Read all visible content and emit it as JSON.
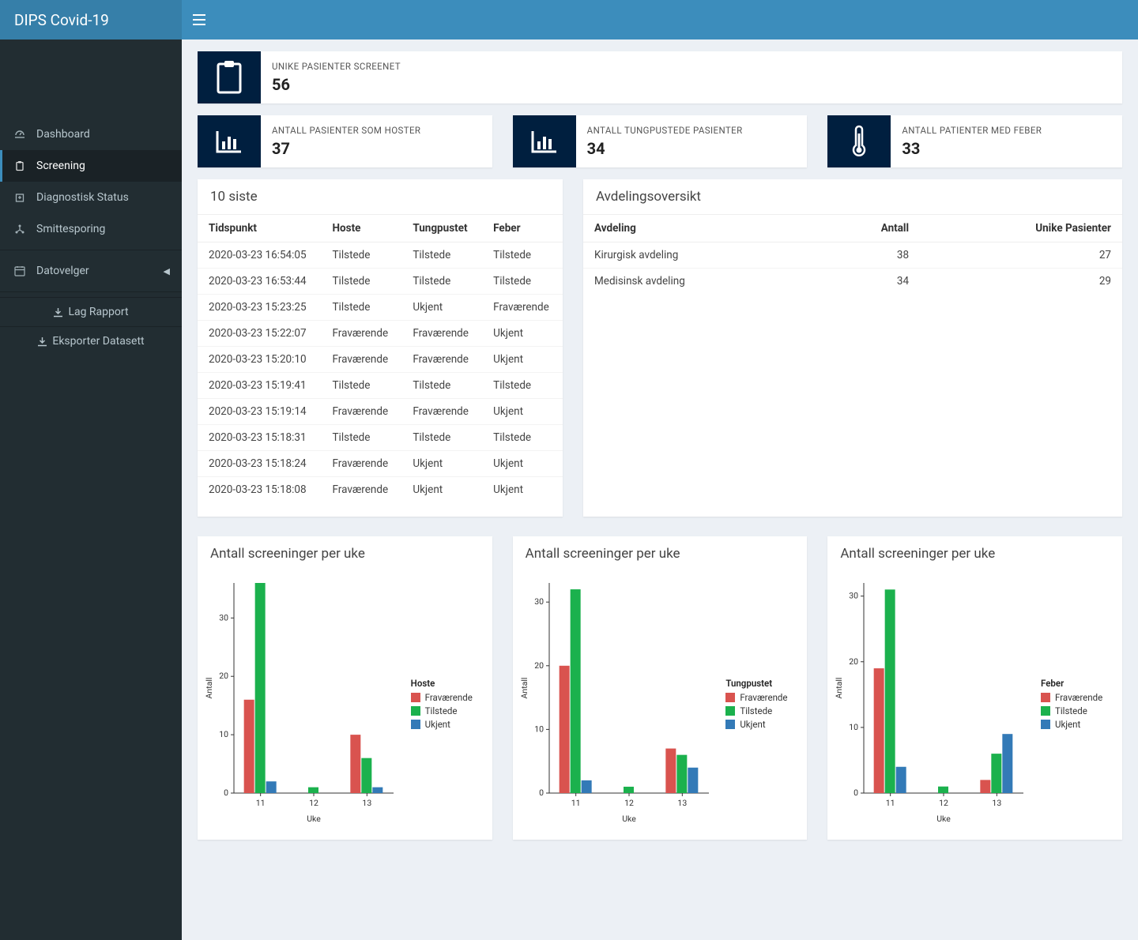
{
  "header": {
    "brand": "DIPS Covid-19"
  },
  "sidebar": {
    "items": [
      {
        "label": "Dashboard",
        "icon": "dashboard"
      },
      {
        "label": "Screening",
        "icon": "clipboard",
        "active": true
      },
      {
        "label": "Diagnostisk Status",
        "icon": "hospital"
      },
      {
        "label": "Smittesporing",
        "icon": "network"
      }
    ],
    "datepicker_label": "Datovelger",
    "report_label": "Lag Rapport",
    "export_label": "Eksporter Datasett"
  },
  "cards": {
    "unique": {
      "label": "UNIKE PASIENTER SCREENET",
      "value": "56"
    },
    "cough": {
      "label": "ANTALL PASIENTER SOM HOSTER",
      "value": "37"
    },
    "breath": {
      "label": "ANTALL TUNGPUSTEDE PASIENTER",
      "value": "34"
    },
    "fever": {
      "label": "ANTALL PATIENTER MED FEBER",
      "value": "33"
    }
  },
  "recent": {
    "title": "10 siste",
    "columns": [
      "Tidspunkt",
      "Hoste",
      "Tungpustet",
      "Feber"
    ],
    "rows": [
      [
        "2020-03-23 16:54:05",
        "Tilstede",
        "Tilstede",
        "Tilstede"
      ],
      [
        "2020-03-23 16:53:44",
        "Tilstede",
        "Tilstede",
        "Tilstede"
      ],
      [
        "2020-03-23 15:23:25",
        "Tilstede",
        "Ukjent",
        "Fraværende"
      ],
      [
        "2020-03-23 15:22:07",
        "Fraværende",
        "Fraværende",
        "Ukjent"
      ],
      [
        "2020-03-23 15:20:10",
        "Fraværende",
        "Fraværende",
        "Ukjent"
      ],
      [
        "2020-03-23 15:19:41",
        "Tilstede",
        "Tilstede",
        "Tilstede"
      ],
      [
        "2020-03-23 15:19:14",
        "Fraværende",
        "Fraværende",
        "Ukjent"
      ],
      [
        "2020-03-23 15:18:31",
        "Tilstede",
        "Tilstede",
        "Tilstede"
      ],
      [
        "2020-03-23 15:18:24",
        "Fraværende",
        "Ukjent",
        "Ukjent"
      ],
      [
        "2020-03-23 15:18:08",
        "Fraværende",
        "Ukjent",
        "Ukjent"
      ]
    ]
  },
  "departments": {
    "title": "Avdelingsoversikt",
    "columns": [
      "Avdeling",
      "Antall",
      "Unike Pasienter"
    ],
    "rows": [
      [
        "Kirurgisk avdeling",
        38,
        27
      ],
      [
        "Medisinsk avdeling",
        34,
        29
      ]
    ]
  },
  "charts_common": {
    "title": "Antall screeninger per uke",
    "xlabel": "Uke",
    "ylabel": "Antall",
    "categories": [
      "11",
      "12",
      "13"
    ],
    "series_names": [
      "Fraværende",
      "Tilstede",
      "Ukjent"
    ],
    "colors": {
      "Fraværende": "#d9534f",
      "Tilstede": "#1bb14d",
      "Ukjent": "#337ab7"
    }
  },
  "chart_data": [
    {
      "type": "bar",
      "title": "Antall screeninger per uke",
      "legend_title": "Hoste",
      "xlabel": "Uke",
      "ylabel": "Antall",
      "categories": [
        "11",
        "12",
        "13"
      ],
      "ylim": [
        0,
        36
      ],
      "yticks": [
        0,
        10,
        20,
        30
      ],
      "series": [
        {
          "name": "Fraværende",
          "values": [
            16,
            0,
            10
          ]
        },
        {
          "name": "Tilstede",
          "values": [
            36,
            1,
            6
          ]
        },
        {
          "name": "Ukjent",
          "values": [
            2,
            0,
            1
          ]
        }
      ]
    },
    {
      "type": "bar",
      "title": "Antall screeninger per uke",
      "legend_title": "Tungpustet",
      "xlabel": "Uke",
      "ylabel": "Antall",
      "categories": [
        "11",
        "12",
        "13"
      ],
      "ylim": [
        0,
        33
      ],
      "yticks": [
        0,
        10,
        20,
        30
      ],
      "series": [
        {
          "name": "Fraværende",
          "values": [
            20,
            0,
            7
          ]
        },
        {
          "name": "Tilstede",
          "values": [
            32,
            1,
            6
          ]
        },
        {
          "name": "Ukjent",
          "values": [
            2,
            0,
            4
          ]
        }
      ]
    },
    {
      "type": "bar",
      "title": "Antall screeninger per uke",
      "legend_title": "Feber",
      "xlabel": "Uke",
      "ylabel": "Antall",
      "categories": [
        "11",
        "12",
        "13"
      ],
      "ylim": [
        0,
        32
      ],
      "yticks": [
        0,
        10,
        20,
        30
      ],
      "series": [
        {
          "name": "Fraværende",
          "values": [
            19,
            0,
            2
          ]
        },
        {
          "name": "Tilstede",
          "values": [
            31,
            1,
            6
          ]
        },
        {
          "name": "Ukjent",
          "values": [
            4,
            0,
            9
          ]
        }
      ]
    }
  ]
}
